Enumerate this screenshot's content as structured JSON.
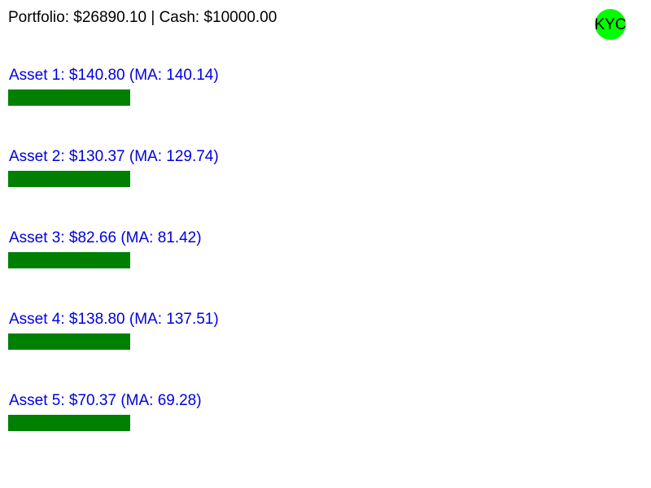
{
  "header": {
    "summary": "Portfolio: $26890.10 | Cash: $10000.00"
  },
  "kyc": {
    "label": "KYC",
    "color": "#00ff00"
  },
  "colors": {
    "asset_label": "#0000dd",
    "bar": "#008000"
  },
  "assets": [
    {
      "label": "Asset 1: $140.80 (MA: 140.14)"
    },
    {
      "label": "Asset 2: $130.37 (MA: 129.74)"
    },
    {
      "label": "Asset 3: $82.66 (MA: 81.42)"
    },
    {
      "label": "Asset 4: $138.80 (MA: 137.51)"
    },
    {
      "label": "Asset 5: $70.37 (MA: 69.28)"
    }
  ]
}
